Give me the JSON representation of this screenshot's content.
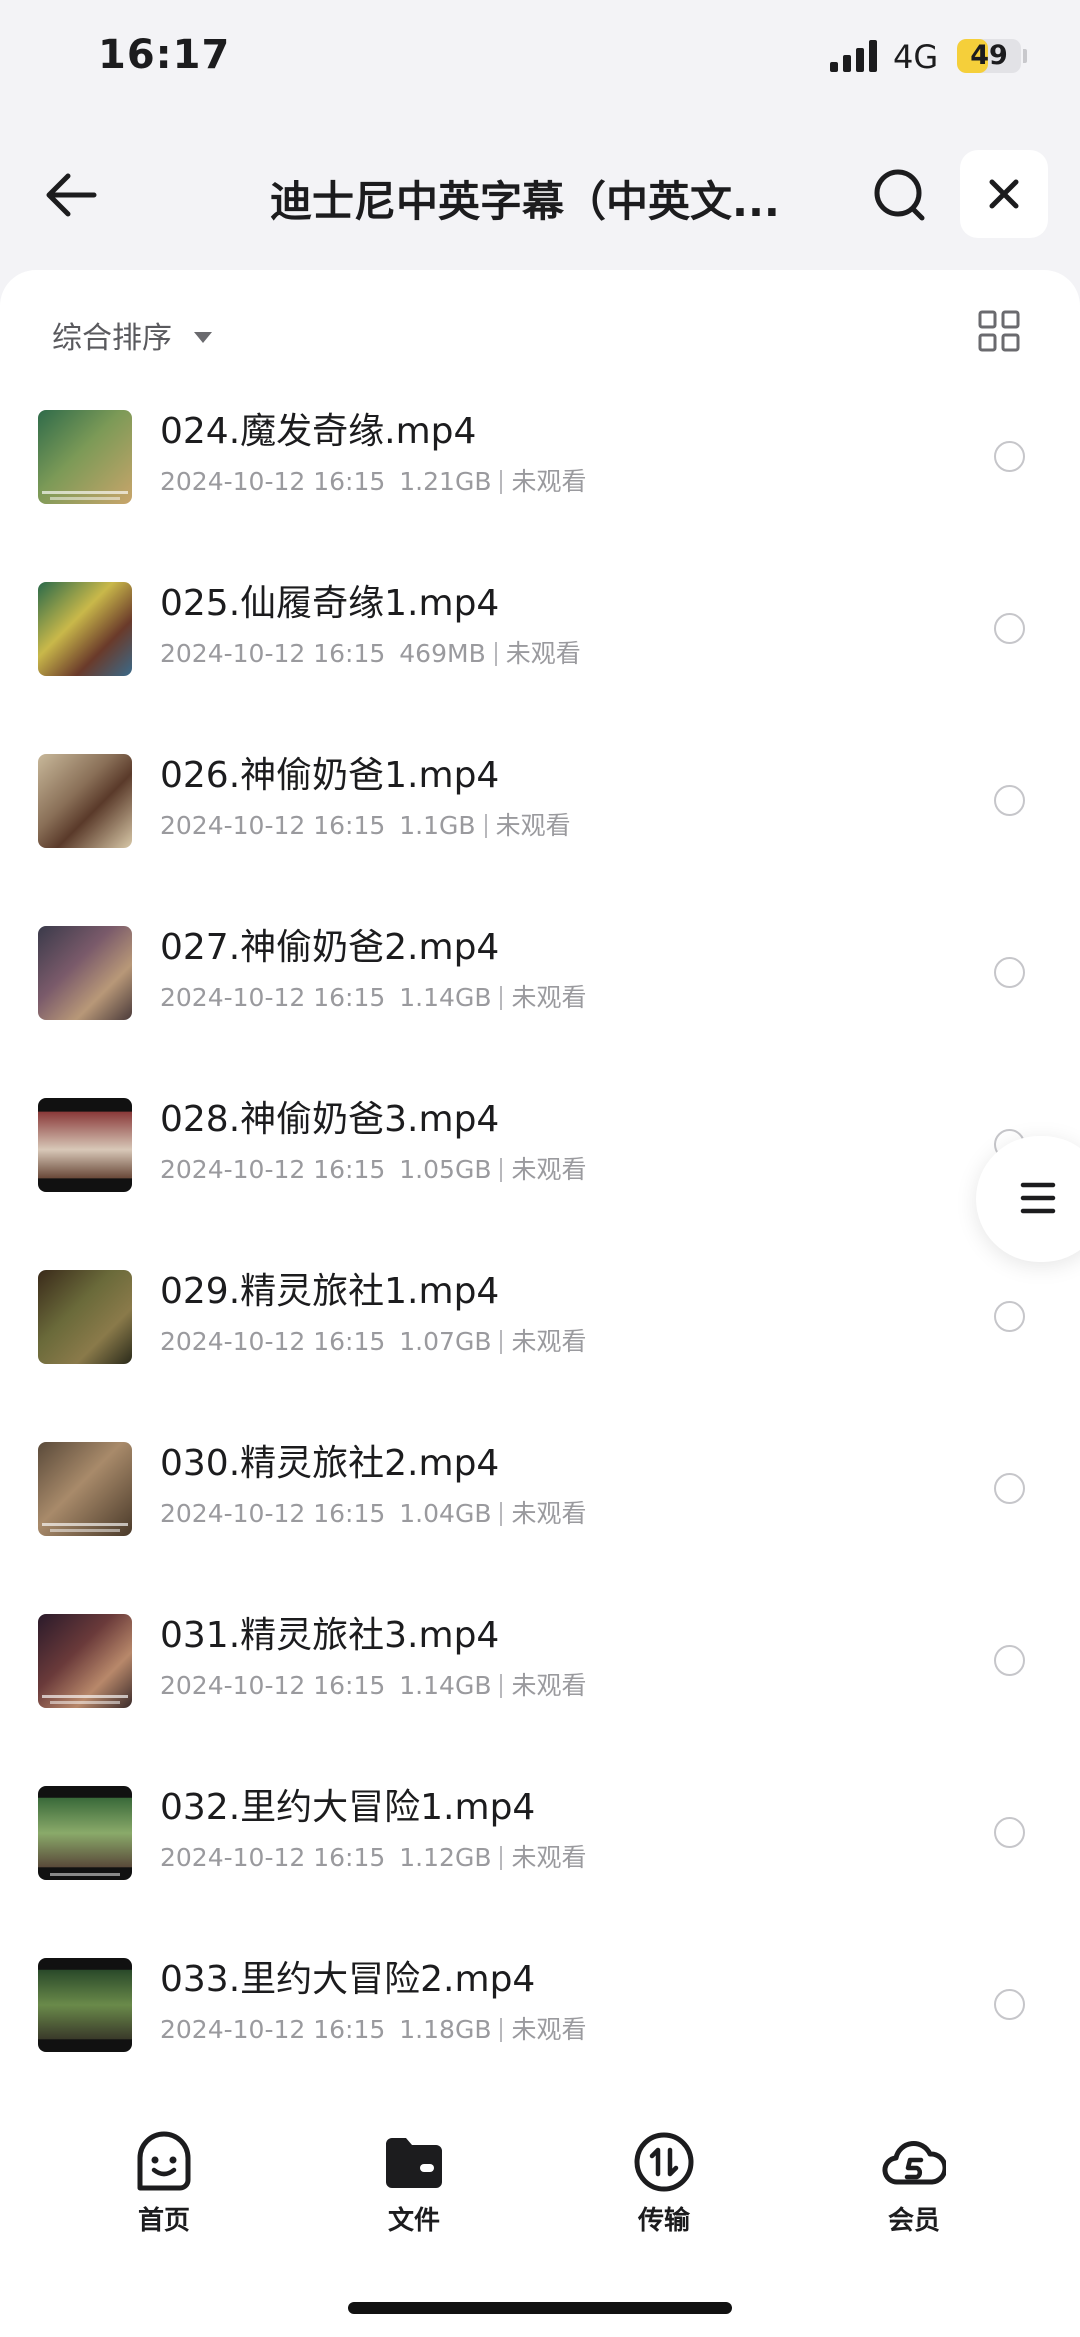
{
  "status": {
    "time": "16:17",
    "network": "4G",
    "battery": "49",
    "battery_level": 0.49
  },
  "header": {
    "title": "迪士尼中英字幕（中英文..."
  },
  "sort": {
    "label": "综合排序"
  },
  "files": [
    {
      "name": "024.魔发奇缘.mp4",
      "date": "2024-10-12 16:15",
      "size": "1.21GB",
      "status": "未观看"
    },
    {
      "name": "025.仙履奇缘1.mp4",
      "date": "2024-10-12 16:15",
      "size": "469MB",
      "status": "未观看"
    },
    {
      "name": "026.神偷奶爸1.mp4",
      "date": "2024-10-12 16:15",
      "size": "1.1GB",
      "status": "未观看"
    },
    {
      "name": "027.神偷奶爸2.mp4",
      "date": "2024-10-12 16:15",
      "size": "1.14GB",
      "status": "未观看"
    },
    {
      "name": "028.神偷奶爸3.mp4",
      "date": "2024-10-12 16:15",
      "size": "1.05GB",
      "status": "未观看"
    },
    {
      "name": "029.精灵旅社1.mp4",
      "date": "2024-10-12 16:15",
      "size": "1.07GB",
      "status": "未观看"
    },
    {
      "name": "030.精灵旅社2.mp4",
      "date": "2024-10-12 16:15",
      "size": "1.04GB",
      "status": "未观看"
    },
    {
      "name": "031.精灵旅社3.mp4",
      "date": "2024-10-12 16:15",
      "size": "1.14GB",
      "status": "未观看"
    },
    {
      "name": "032.里约大冒险1.mp4",
      "date": "2024-10-12 16:15",
      "size": "1.12GB",
      "status": "未观看"
    },
    {
      "name": "033.里约大冒险2.mp4",
      "date": "2024-10-12 16:15",
      "size": "1.18GB",
      "status": "未观看"
    }
  ],
  "tabs": [
    {
      "label": "首页",
      "icon": "smile-icon"
    },
    {
      "label": "文件",
      "icon": "folder-icon"
    },
    {
      "label": "传输",
      "icon": "transfer-icon"
    },
    {
      "label": "会员",
      "icon": "cloud-member-icon"
    }
  ]
}
